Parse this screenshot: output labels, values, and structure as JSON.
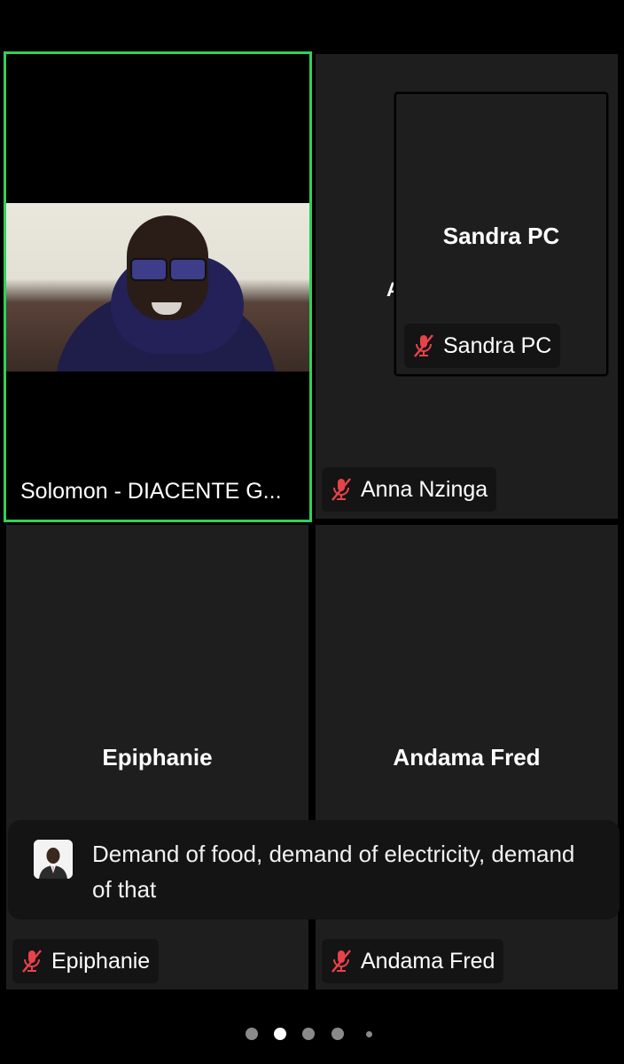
{
  "participants": {
    "active": {
      "label": "Solomon - DIACENTE G..."
    },
    "top_right": {
      "label": "Anna Nzinga"
    },
    "pip": {
      "center_name": "Sandra PC",
      "label": "Sandra PC"
    },
    "bottom_left": {
      "center_name": "Epiphanie",
      "label": "Epiphanie"
    },
    "bottom_right": {
      "center_name": "Andama Fred",
      "label": "Andama Fred"
    }
  },
  "caption": {
    "text": "Demand of food, demand of electricity, demand of that"
  },
  "pagination": {
    "pages": 5,
    "current": 2
  },
  "colors": {
    "active_border": "#2fd158",
    "muted_mic": "#e8424a",
    "tile_bg": "#1e1e1e"
  },
  "icons": {
    "muted": "mic-off-icon"
  }
}
